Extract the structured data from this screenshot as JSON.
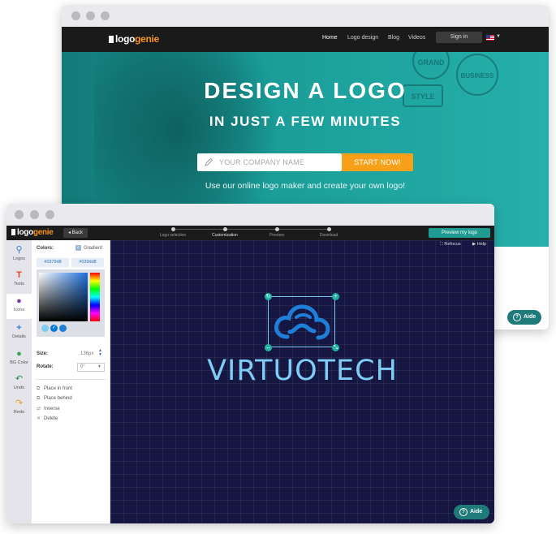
{
  "back_window": {
    "logo": {
      "part1": "logo",
      "part2": "genie"
    },
    "nav": {
      "home": "Home",
      "logo_design": "Logo design",
      "blog": "Blog",
      "videos": "Videos",
      "signin": "Sign in"
    },
    "hero": {
      "headline1": "DESIGN A LOGO",
      "headline2": "IN JUST A FEW MINUTES",
      "input_placeholder": "YOUR COMPANY NAME",
      "cta": "START NOW!",
      "subtitle": "Use our online logo maker and create your own logo!",
      "badges": [
        "GRAND",
        "BUSINESS",
        "STYLE"
      ]
    },
    "help_label": "Aide"
  },
  "front_window": {
    "logo": {
      "part1": "logo",
      "part2": "genie"
    },
    "back_label": "Back",
    "steps": [
      {
        "label": "Logo selection",
        "active": false
      },
      {
        "label": "Customization",
        "active": true
      },
      {
        "label": "Preview",
        "active": false
      },
      {
        "label": "Download",
        "active": false
      }
    ],
    "preview_button": "Preview my logo",
    "refocus": "Refocus",
    "help": "Help",
    "tools": [
      {
        "label": "Logos",
        "icon": "search-icon",
        "glyph": "⚲",
        "color": "#3a7bd5"
      },
      {
        "label": "Texts",
        "icon": "text-icon",
        "glyph": "T",
        "color": "#e0452f"
      },
      {
        "label": "Icons",
        "icon": "icons-icon",
        "glyph": "●",
        "color": "#7b3fa0"
      },
      {
        "label": "Details",
        "icon": "plus-icon",
        "glyph": "+",
        "color": "#3a7bd5"
      },
      {
        "label": "BG Color",
        "icon": "drop-icon",
        "glyph": "●",
        "color": "#3aa35b"
      },
      {
        "label": "Undo",
        "icon": "undo-icon",
        "glyph": "↶",
        "color": "#2a8a4a"
      },
      {
        "label": "Redo",
        "icon": "redo-icon",
        "glyph": "↷",
        "color": "#e8962a"
      }
    ],
    "panel": {
      "colors_label": "Colors:",
      "gradient_label": "Gradient",
      "color1": "#0379d8",
      "color2": "#039dd8",
      "size_label": "Size:",
      "size_value": "136px",
      "rotate_label": "Rotate:",
      "rotate_value": "0°",
      "actions": [
        "Place in front",
        "Place behind",
        "Inverse",
        "Delete"
      ]
    },
    "canvas": {
      "brand_text": "VIRTUOTECH",
      "text_color": "#7fcdf5",
      "bg_color": "#161643"
    },
    "help_label": "Aide"
  }
}
